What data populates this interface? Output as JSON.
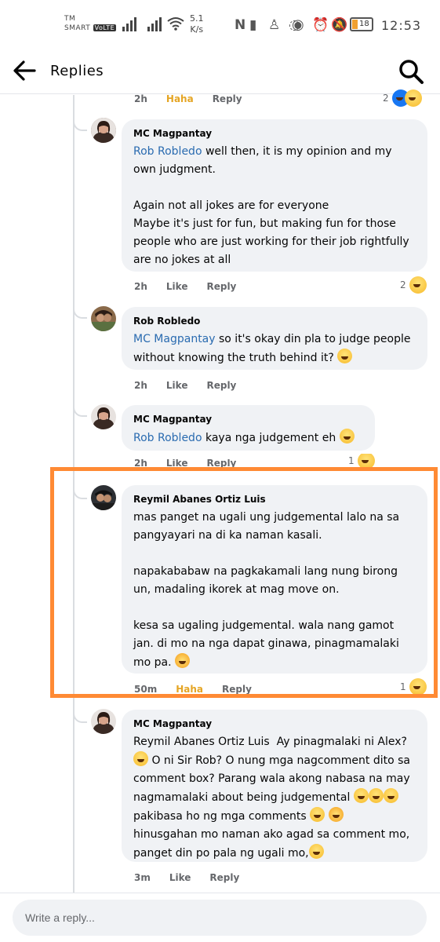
{
  "status_bar": {
    "carrier_tm": "TM",
    "carrier_name": "SMART",
    "carrier_tag": "VoLTE",
    "net_speed_value": "5.1",
    "net_speed_unit": "K/s",
    "battery_level": "18",
    "time": "12:53",
    "icons": [
      "signal-icon",
      "wifi-icon",
      "n-app-icon",
      "snapchat-icon",
      "messenger-icon",
      "eye-icon",
      "alarm-icon",
      "mute-icon",
      "battery-icon"
    ]
  },
  "header": {
    "title": "Replies",
    "back_icon": "arrow-left-icon",
    "search_icon": "search-icon"
  },
  "top_meta": {
    "time": "2h",
    "reaction": "Haha",
    "reply": "Reply",
    "count": "2"
  },
  "comments": [
    {
      "author": "MC Magpantay",
      "mention": "Rob Robledo",
      "text_after_mention": " well then, it is my opinion and my own judgment.\n\nAgain not all jokes are for everyone\nMaybe it's just for fun, but making fun for those people who are just working for their job rightfully are no jokes at all",
      "time": "2h",
      "like": "Like",
      "reply": "Reply",
      "reaction_count": "2"
    },
    {
      "author": "Rob Robledo",
      "mention": "MC Magpantay",
      "text_after_mention": " so it's okay din pla to judge people without knowing the truth behind it? ",
      "time": "2h",
      "like": "Like",
      "reply": "Reply"
    },
    {
      "author": "MC Magpantay",
      "mention": "Rob Robledo",
      "text_after_mention": " kaya nga judgement eh ",
      "time": "2h",
      "like": "Like",
      "reply": "Reply",
      "reaction_count": "1"
    },
    {
      "author": "Reymil Abanes Ortiz Luis",
      "text": "mas panget na ugali ung judgemental lalo na sa pangyayari na di ka naman kasali.\n\nnapakababaw na pagkakamali lang nung birong un, madaling ikorek at mag move on.\n\nkesa sa ugaling judgemental. wala nang gamot jan. di mo na nga dapat ginawa, pinagmamalaki mo pa. ",
      "time": "50m",
      "reaction": "Haha",
      "reply": "Reply",
      "reaction_count": "1"
    },
    {
      "author": "MC Magpantay",
      "text": "Reymil Abanes Ortiz Luis  Ay pinagmalaki ni Alex? ",
      "text_2": " O ni Sir Rob? O nung mga nagcomment dito sa comment box? Parang wala akong nabasa na may nagmamalaki about being judgemental ",
      "text_3": "\npakibasa ho ng mga comments ",
      "text_4": "\nhinusgahan mo naman ako agad sa comment mo, panget din po pala ng ugali mo,",
      "time": "3m",
      "like": "Like",
      "reply": "Reply"
    }
  ],
  "composer": {
    "placeholder": "Write a reply..."
  },
  "colors": {
    "highlight": "#ff8a34",
    "mention": "#2a6bb0",
    "haha": "#e5a524",
    "bubble": "#f0f2f5"
  }
}
